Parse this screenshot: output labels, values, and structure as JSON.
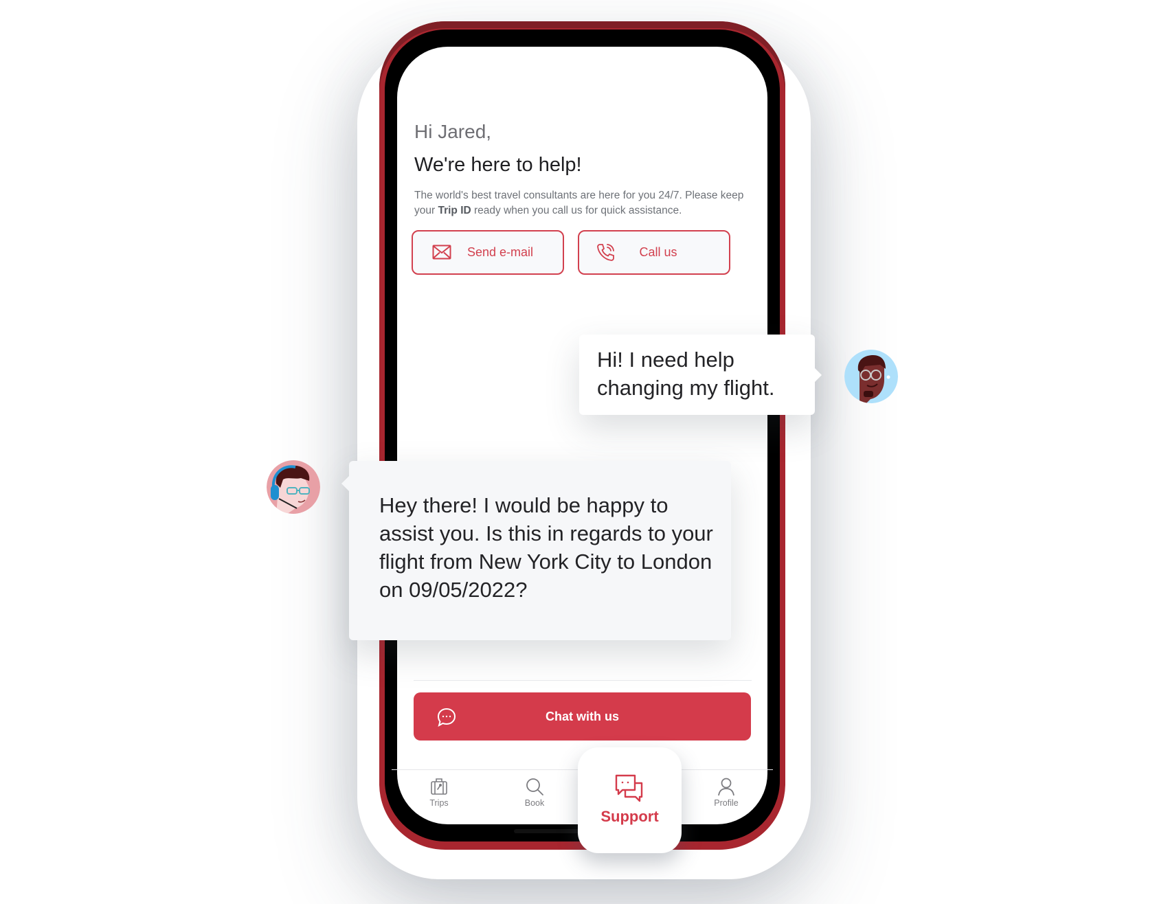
{
  "header": {
    "greeting": "Hi Jared,",
    "title": "We're here to help!",
    "intro_before": "The world's best travel consultants are here for you 24/7. Please keep your ",
    "intro_bold": "Trip ID",
    "intro_after": " ready when you call us for quick assistance."
  },
  "actions": {
    "email_label": "Send e-mail",
    "email_icon": "envelope-icon",
    "call_label": "Call us",
    "call_icon": "phone-ringing-icon"
  },
  "chat": {
    "user_message": "Hi! I need help changing my flight.",
    "agent_message": "Hey there! I would be happy to assist you. Is this in regards to your flight from New York City to London on 09/05/2022?"
  },
  "chat_button": {
    "label": "Chat with us",
    "icon": "chat-bubble-icon"
  },
  "tabbar": {
    "tabs": [
      {
        "label": "Trips",
        "icon": "suitcase-icon",
        "active": false
      },
      {
        "label": "Book",
        "icon": "search-icon",
        "active": false
      },
      {
        "label": "Support",
        "icon": "support-chat-icon",
        "active": true
      },
      {
        "label": "Profile",
        "icon": "user-icon",
        "active": false
      }
    ]
  },
  "colors": {
    "accent": "#d43b4b",
    "phone_frame": "#a8262f",
    "agent_bubble": "#f6f7f9",
    "user_avatar_bg": "#aee0fb",
    "agent_avatar_bg": "#e8a0a6"
  }
}
